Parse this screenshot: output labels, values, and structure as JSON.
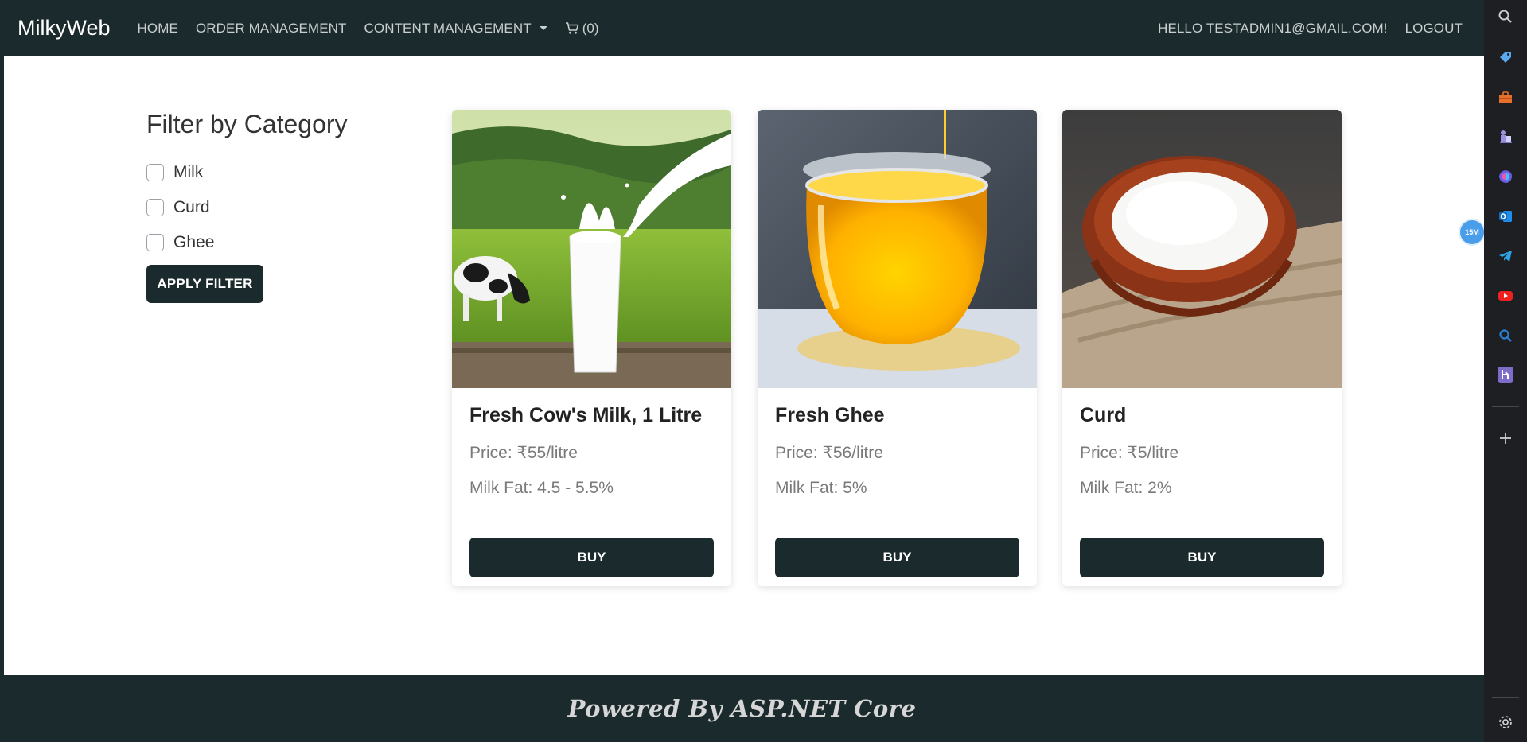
{
  "nav": {
    "brand": "MilkyWeb",
    "home": "HOME",
    "order_management": "ORDER MANAGEMENT",
    "content_management": "CONTENT MANAGEMENT",
    "cart_count": "(0)",
    "greeting": "HELLO TESTADMIN1@GMAIL.COM!",
    "logout": "LOGOUT"
  },
  "filter": {
    "title": "Filter by Category",
    "options": [
      "Milk",
      "Curd",
      "Ghee"
    ],
    "apply_label": "APPLY FILTER"
  },
  "products": [
    {
      "name": "Fresh Cow's Milk, 1 Litre",
      "price": "Price: ₹55/litre",
      "fat": "Milk Fat: 4.5 - 5.5%",
      "buy_label": "BUY"
    },
    {
      "name": "Fresh Ghee",
      "price": "Price: ₹56/litre",
      "fat": "Milk Fat: 5%",
      "buy_label": "BUY"
    },
    {
      "name": "Curd",
      "price": "Price: ₹5/litre",
      "fat": "Milk Fat: 2%",
      "buy_label": "BUY"
    }
  ],
  "footer": {
    "text": "Powered By ASP.NET Core"
  },
  "browser_sidebar": {
    "badge": "15M",
    "icons": [
      "search-icon",
      "tag-icon",
      "briefcase-icon",
      "chess-icon",
      "copilot-icon",
      "outlook-icon",
      "telegram-icon",
      "youtube-icon",
      "search-alt-icon",
      "h-app-icon",
      "plus-icon",
      "settings-icon"
    ]
  },
  "colors": {
    "primary": "#1b2a2c",
    "sidebar": "#1e1f22"
  }
}
